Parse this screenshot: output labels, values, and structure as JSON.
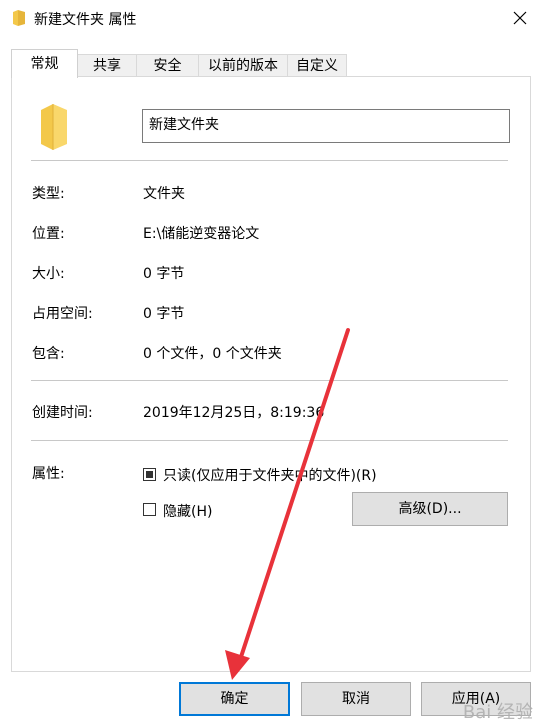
{
  "window": {
    "title": "新建文件夹 属性"
  },
  "tabs": [
    {
      "label": "常规"
    },
    {
      "label": "共享"
    },
    {
      "label": "安全"
    },
    {
      "label": "以前的版本"
    },
    {
      "label": "自定义"
    }
  ],
  "general": {
    "folder_name": "新建文件夹",
    "rows": {
      "type": {
        "label": "类型:",
        "value": "文件夹"
      },
      "location": {
        "label": "位置:",
        "value": "E:\\储能逆变器论文"
      },
      "size": {
        "label": "大小:",
        "value": "0 字节"
      },
      "size_on_disk": {
        "label": "占用空间:",
        "value": "0 字节"
      },
      "contains": {
        "label": "包含:",
        "value": "0 个文件，0 个文件夹"
      },
      "created": {
        "label": "创建时间:",
        "value": "2019年12月25日，8:19:36"
      }
    },
    "attributes": {
      "label": "属性:",
      "readonly_label": "只读(仅应用于文件夹中的文件)(R)",
      "hidden_label": "隐藏(H)",
      "advanced_label": "高级(D)..."
    }
  },
  "footer": {
    "ok_label": "确定",
    "cancel_label": "取消",
    "apply_label": "应用(A)"
  },
  "watermark": {
    "text": "Bai 经验"
  },
  "colors": {
    "accent": "#0078d7",
    "folder": "#f3c84a",
    "arrow": "#e8323a"
  }
}
